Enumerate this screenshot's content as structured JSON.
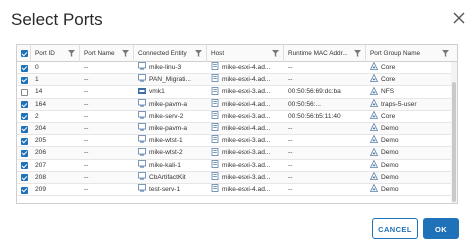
{
  "dialog": {
    "title": "Select Ports",
    "cancel_label": "CANCEL",
    "ok_label": "OK"
  },
  "columns": [
    "Port ID",
    "Port Name",
    "Connected Entity",
    "Host",
    "Runtime MAC Addr...",
    "Port Group Name"
  ],
  "rows": [
    {
      "checked": true,
      "port_id": "0",
      "port_name": "--",
      "entity": "mike-linu-3",
      "entity_icon": "vm-icon",
      "host": "mike-esxi-4.ad...",
      "mac": "--",
      "group": "Core"
    },
    {
      "checked": true,
      "port_id": "1",
      "port_name": "--",
      "entity": "PAN_Migrati...",
      "entity_icon": "vm-icon",
      "host": "mike-esxi-4.ad...",
      "mac": "--",
      "group": "Core"
    },
    {
      "checked": false,
      "port_id": "14",
      "port_name": "--",
      "entity": "vmk1",
      "entity_icon": "vmk-icon",
      "host": "mike-esxi-3.ad...",
      "mac": "00:50:56:69:dc:ba",
      "group": "NFS"
    },
    {
      "checked": true,
      "port_id": "164",
      "port_name": "--",
      "entity": "mike-pavm-a",
      "entity_icon": "vm-icon",
      "host": "mike-esxi-4.ad...",
      "mac": "00:50:56:...",
      "group": "traps-5-user"
    },
    {
      "checked": true,
      "port_id": "2",
      "port_name": "--",
      "entity": "mike-serv-2",
      "entity_icon": "vm-icon",
      "host": "mike-esxi-3.ad...",
      "mac": "00:50:56:b5:11:40",
      "group": "Core"
    },
    {
      "checked": true,
      "port_id": "204",
      "port_name": "--",
      "entity": "mike-pavm-a",
      "entity_icon": "vm-icon",
      "host": "mike-esxi-4.ad...",
      "mac": "--",
      "group": "Demo"
    },
    {
      "checked": true,
      "port_id": "205",
      "port_name": "--",
      "entity": "mike-wtst-1",
      "entity_icon": "vm-icon",
      "host": "mike-esxi-3.ad...",
      "mac": "--",
      "group": "Demo"
    },
    {
      "checked": true,
      "port_id": "206",
      "port_name": "--",
      "entity": "mike-wtst-2",
      "entity_icon": "vm-icon",
      "host": "mike-esxi-3.ad...",
      "mac": "--",
      "group": "Demo"
    },
    {
      "checked": true,
      "port_id": "207",
      "port_name": "--",
      "entity": "mike-kali-1",
      "entity_icon": "vm-icon",
      "host": "mike-esxi-3.ad...",
      "mac": "--",
      "group": "Demo"
    },
    {
      "checked": true,
      "port_id": "208",
      "port_name": "--",
      "entity": "CbArtifactKit",
      "entity_icon": "vm-icon",
      "host": "mike-esxi-3.ad...",
      "mac": "--",
      "group": "Demo"
    },
    {
      "checked": true,
      "port_id": "209",
      "port_name": "--",
      "entity": "test-serv-1",
      "entity_icon": "vm-icon",
      "host": "mike-esxi-4.ad...",
      "mac": "--",
      "group": "Demo"
    }
  ],
  "colors": {
    "accent": "#1f71b8",
    "border": "#cfcfcf"
  }
}
